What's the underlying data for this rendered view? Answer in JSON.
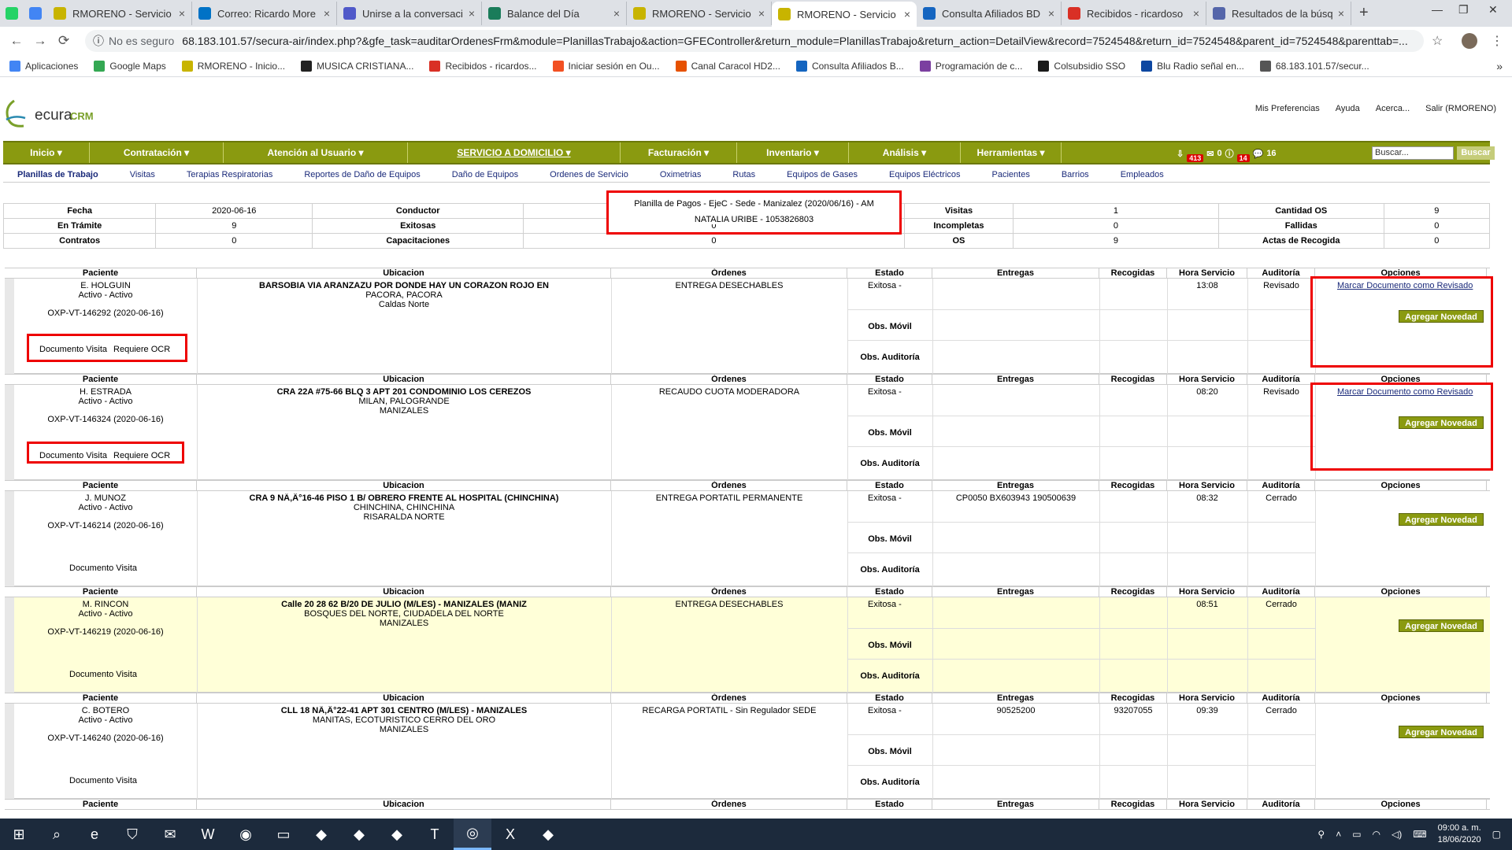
{
  "browser": {
    "tabs": [
      {
        "title": "",
        "icon": "whatsapp-icon",
        "color": "#25d366",
        "pinned": true
      },
      {
        "title": "",
        "icon": "maps-icon",
        "color": "#4285f4",
        "pinned": true
      },
      {
        "title": "RMORENO - Servicio",
        "icon": "secura-icon",
        "color": "#c8b400"
      },
      {
        "title": "Correo: Ricardo More",
        "icon": "outlook-icon",
        "color": "#0072c6"
      },
      {
        "title": "Unirse a la conversaci",
        "icon": "teams-icon",
        "color": "#5059c9"
      },
      {
        "title": "Balance del Día",
        "icon": "sheets-icon",
        "color": "#1a7c5a"
      },
      {
        "title": "RMORENO - Servicio",
        "icon": "secura-icon",
        "color": "#c8b400"
      },
      {
        "title": "RMORENO - Servicio",
        "icon": "secura-icon",
        "color": "#c8b400",
        "active": true
      },
      {
        "title": "Consulta Afiliados BD",
        "icon": "triangle-icon",
        "color": "#1565c0"
      },
      {
        "title": "Recibidos - ricardoso",
        "icon": "gmail-icon",
        "color": "#d93025"
      },
      {
        "title": "Resultados de la búsq",
        "icon": "flag-icon",
        "color": "#5566aa"
      }
    ],
    "url_not_secure": "No es seguro",
    "url": "68.183.101.57/secura-air/index.php?&gfe_task=auditarOrdenesFrm&module=PlanillasTrabajo&action=GFEController&return_module=PlanillasTrabajo&return_action=DetailView&record=7524548&return_id=7524548&parent_id=7524548&parenttab=...",
    "bookmarks": [
      {
        "label": "Aplicaciones",
        "color": "#4285f4"
      },
      {
        "label": "Google Maps",
        "color": "#34a853"
      },
      {
        "label": "RMORENO - Inicio...",
        "color": "#c8b400"
      },
      {
        "label": "MUSICA CRISTIANA...",
        "color": "#222222"
      },
      {
        "label": "Recibidos - ricardos...",
        "color": "#d93025"
      },
      {
        "label": "Iniciar sesión en Ou...",
        "color": "#f25022"
      },
      {
        "label": "Canal Caracol HD2...",
        "color": "#e65100"
      },
      {
        "label": "Consulta Afiliados B...",
        "color": "#1565c0"
      },
      {
        "label": "Programación de c...",
        "color": "#7b3fa0"
      },
      {
        "label": "Colsubsidio SSO",
        "color": "#1a1a1a"
      },
      {
        "label": "Blu Radio señal en...",
        "color": "#0d47a1"
      },
      {
        "label": "68.183.101.57/secur...",
        "color": "#555555"
      }
    ]
  },
  "app": {
    "logo_text": "ecura",
    "logo_sub": "CRM",
    "top_links": [
      "Mis Preferencias",
      "Ayuda",
      "Acerca...",
      "Salir (RMORENO)"
    ],
    "main_nav": [
      {
        "label": "Inicio ▾",
        "w": 110
      },
      {
        "label": "Contratación ▾",
        "w": 170
      },
      {
        "label": "Atención al Usuario ▾",
        "w": 234
      },
      {
        "label": "SERVICIO A DOMICILIO ▾",
        "w": 270,
        "active": true
      },
      {
        "label": "Facturación ▾",
        "w": 148
      },
      {
        "label": "Inventario ▾",
        "w": 142
      },
      {
        "label": "Análisis ▾",
        "w": 142
      },
      {
        "label": "Herramientas ▾",
        "w": 128
      }
    ],
    "nav_counts": {
      "inbox": "413",
      "inbox_top": "4623",
      "msg": "0",
      "alert": "14",
      "alert_top": "160",
      "chat": "16"
    },
    "search_placeholder": "Buscar...",
    "search_button": "Buscar",
    "sub_nav": [
      "Planillas de Trabajo",
      "Visitas",
      "Terapias Respiratorias",
      "Reportes de Daño de Equipos",
      "Daño de Equipos",
      "Ordenes de Servicio",
      "Oximetrias",
      "Rutas",
      "Equipos de Gases",
      "Equipos Eléctricos",
      "Pacientes",
      "Barrios",
      "Empleados"
    ]
  },
  "summary": {
    "title": "Planilla de Pagos - EjeC - Sede - Manizalez (2020/06/16) - AM",
    "conductor_value": "NATALIA URIBE - 1053826803",
    "rows": [
      [
        "Fecha",
        "2020-06-16",
        "Conductor",
        "",
        "Visitas",
        "1",
        "Cantidad OS",
        "9"
      ],
      [
        "En Trámite",
        "9",
        "Exitosas",
        "0",
        "Incompletas",
        "0",
        "Fallidas",
        "0"
      ],
      [
        "Contratos",
        "0",
        "Capacitaciones",
        "0",
        "OS",
        "9",
        "Actas de Recogida",
        "0"
      ]
    ]
  },
  "columns": [
    "Paciente",
    "Ubicacion",
    "Órdenes",
    "Estado",
    "Entregas",
    "Recogidas",
    "Hora Servicio",
    "Auditoría",
    "Opciones"
  ],
  "labels": {
    "obs_movil": "Obs. Móvil",
    "obs_auditoria": "Obs. Auditoría",
    "agregar": "Agregar Novedad",
    "marcar": "Marcar Documento como Revisado",
    "doc_visita": "Documento Visita",
    "requiere_ocr": "Requiere OCR"
  },
  "records": [
    {
      "name": "E. HOLGUIN",
      "status": "Activo - Activo",
      "code": "OXP-VT-146292 (2020-06-16)",
      "addr1": "BARSOBIA VIA ARANZAZU POR DONDE HAY UN CORAZON ROJO EN",
      "addr2": "PACORA, PACORA",
      "addr3": "Caldas Norte",
      "orden": "ENTREGA DESECHABLES",
      "estado": "Exitosa -",
      "entregas": "",
      "recogidas": "",
      "hora": "13:08",
      "auditoria": "Revisado",
      "ocr": true,
      "marcar": true,
      "yellow": false
    },
    {
      "name": "H. ESTRADA",
      "status": "Activo - Activo",
      "code": "OXP-VT-146324 (2020-06-16)",
      "addr1": "CRA 22A #75-66 BLQ 3 APT 201 CONDOMINIO LOS CEREZOS",
      "addr2": "MILAN, PALOGRANDE",
      "addr3": "MANIZALES",
      "orden": "RECAUDO CUOTA MODERADORA",
      "estado": "Exitosa -",
      "entregas": "",
      "recogidas": "",
      "hora": "08:20",
      "auditoria": "Revisado",
      "ocr": true,
      "marcar": true,
      "yellow": false
    },
    {
      "name": "J. MUNOZ",
      "status": "Activo - Activo",
      "code": "OXP-VT-146214 (2020-06-16)",
      "addr1": "CRA 9 NÃ‚Â°16-46 PISO 1 B/ OBRERO FRENTE AL HOSPITAL (CHINCHINA)",
      "addr2": "CHINCHINA, CHINCHINA",
      "addr3": "RISARALDA NORTE",
      "orden": "ENTREGA PORTATIL PERMANENTE",
      "estado": "Exitosa -",
      "entregas": "CP0050 BX603943 190500639",
      "recogidas": "",
      "hora": "08:32",
      "auditoria": "Cerrado",
      "ocr": false,
      "marcar": false,
      "yellow": false
    },
    {
      "name": "M. RINCON",
      "status": "Activo - Activo",
      "code": "OXP-VT-146219 (2020-06-16)",
      "addr1": "Calle 20 28 62 B/20 DE JULIO (M/LES) - MANIZALES (MANIZ",
      "addr2": "BOSQUES DEL NORTE, CIUDADELA DEL NORTE",
      "addr3": "MANIZALES",
      "orden": "ENTREGA DESECHABLES",
      "estado": "Exitosa -",
      "entregas": "",
      "recogidas": "",
      "hora": "08:51",
      "auditoria": "Cerrado",
      "ocr": false,
      "marcar": false,
      "yellow": true
    },
    {
      "name": "C. BOTERO",
      "status": "Activo - Activo",
      "code": "OXP-VT-146240 (2020-06-16)",
      "addr1": "CLL 18 NÃ‚Â°22-41 APT 301 CENTRO (M/LES) - MANIZALES",
      "addr2": "MANITAS, ECOTURISTICO CERRO DEL ORO",
      "addr3": "MANIZALES",
      "orden": "RECARGA PORTATIL - Sin Regulador SEDE",
      "estado": "Exitosa -",
      "entregas": "90525200",
      "recogidas": "93207055",
      "hora": "09:39",
      "auditoria": "Cerrado",
      "ocr": false,
      "marcar": false,
      "yellow": false
    }
  ],
  "taskbar": {
    "apps": [
      "windows-icon",
      "search-icon",
      "edge-icon",
      "store-icon",
      "mail-icon",
      "word-icon",
      "zoom-icon",
      "explorer-icon",
      "app-icon",
      "app-icon",
      "app-icon",
      "teams-icon",
      "chrome-icon",
      "excel-icon",
      "app-icon"
    ],
    "time": "09:00 a. m.",
    "date": "18/06/2020"
  }
}
